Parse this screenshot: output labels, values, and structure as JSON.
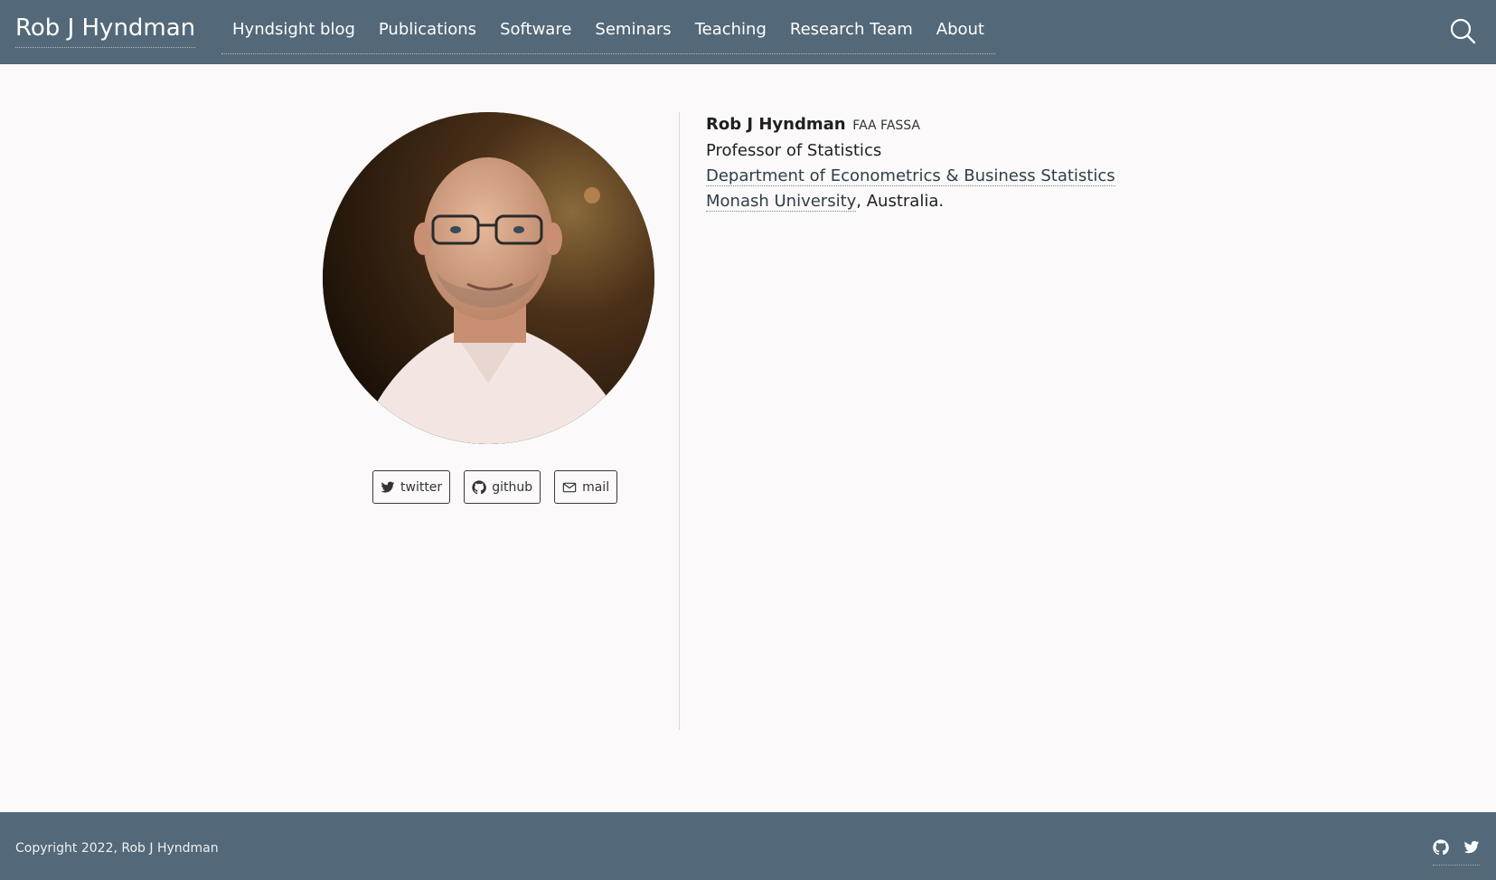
{
  "header": {
    "brand": "Rob J Hyndman",
    "nav": [
      {
        "label": "Hyndsight blog"
      },
      {
        "label": "Publications"
      },
      {
        "label": "Software"
      },
      {
        "label": "Seminars"
      },
      {
        "label": "Teaching"
      },
      {
        "label": "Research Team"
      },
      {
        "label": "About"
      }
    ],
    "search_icon": "search-icon"
  },
  "profile": {
    "photo_alt": "Rob J Hyndman",
    "social": [
      {
        "label": "twitter",
        "icon": "twitter-icon"
      },
      {
        "label": "github",
        "icon": "github-icon"
      },
      {
        "label": "mail",
        "icon": "mail-icon"
      }
    ]
  },
  "info": {
    "name": "Rob J Hyndman",
    "honors": "FAA FASSA",
    "title": "Professor of Statistics",
    "department": "Department of Econometrics & Business Statistics",
    "university": "Monash University",
    "country_suffix": ", Australia."
  },
  "footer": {
    "copyright": "Copyright 2022, Rob J Hyndman",
    "icons": [
      "github-icon",
      "twitter-icon"
    ]
  },
  "colors": {
    "header_bg": "#536878",
    "page_bg": "#fbf9f9",
    "text": "#1f1f1f"
  }
}
